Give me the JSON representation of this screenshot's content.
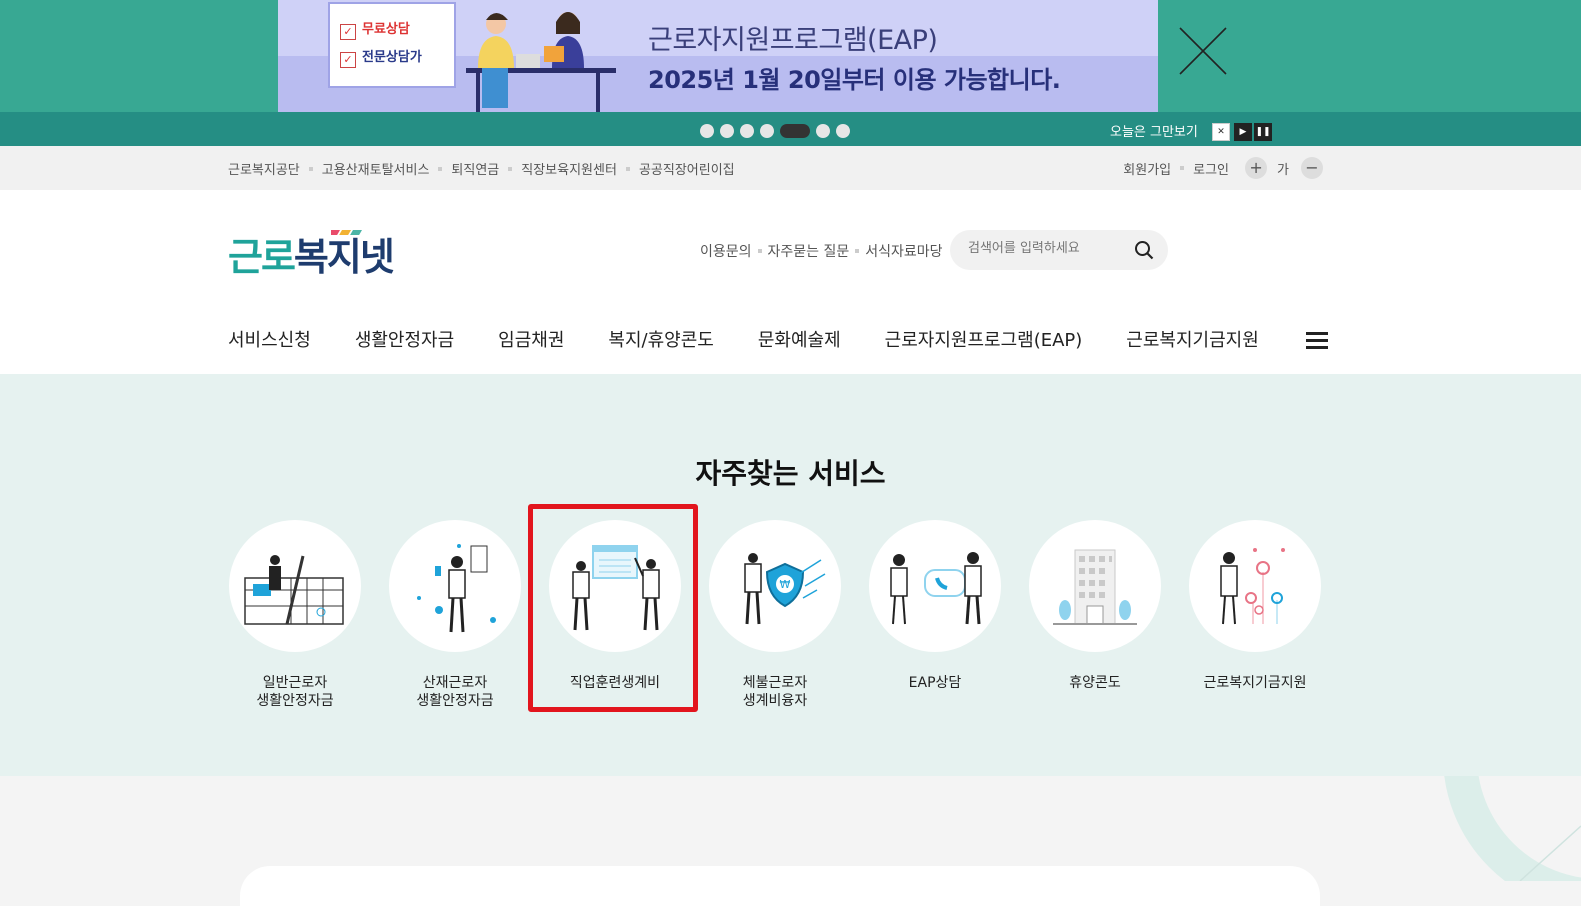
{
  "promo": {
    "card_row1": "무료상담",
    "card_row2": "전문상담가",
    "title": "근로자지원프로그램(EAP)",
    "subtitle": "2025년  1월 20일부터 이용 가능합니다.",
    "today_close": "오늘은 그만보기",
    "dot_count": 7,
    "active_dot": 5
  },
  "util": {
    "links": [
      "근로복지공단",
      "고용산재토탈서비스",
      "퇴직연금",
      "직장보육지원센터",
      "공공직장어린이집"
    ],
    "join": "회원가입",
    "login": "로그인",
    "font_label": "가"
  },
  "header": {
    "logo_a": "근로",
    "logo_b": "복지넷",
    "quick": [
      "이용문의",
      "자주묻는 질문",
      "서식자료마당"
    ],
    "search_placeholder": "검색어를 입력하세요"
  },
  "gnb": [
    "서비스신청",
    "생활안정자금",
    "임금채권",
    "복지/휴양콘도",
    "문화예술제",
    "근로자지원프로그램(EAP)",
    "근로복지기금지원"
  ],
  "services": {
    "title": "자주찾는 서비스",
    "items": [
      {
        "label": "일반근로자\n생활안정자금",
        "icon": "calendar-worker-icon"
      },
      {
        "label": "산재근로자\n생활안정자금",
        "icon": "injured-worker-icon"
      },
      {
        "label": "직업훈련생계비",
        "icon": "training-presentation-icon"
      },
      {
        "label": "체불근로자\n생계비융자",
        "icon": "wage-shield-icon"
      },
      {
        "label": "EAP상담",
        "icon": "phone-counsel-icon"
      },
      {
        "label": "휴양콘도",
        "icon": "condo-building-icon"
      },
      {
        "label": "근로복지기금지원",
        "icon": "fund-flower-icon"
      }
    ]
  },
  "colors": {
    "promo_bg": "#38a893",
    "promo_bar": "#258e84",
    "brand_teal": "#1fa39a",
    "brand_navy": "#1e3c6e",
    "services_bg": "#e6f2f0",
    "highlight": "#e2151d"
  }
}
